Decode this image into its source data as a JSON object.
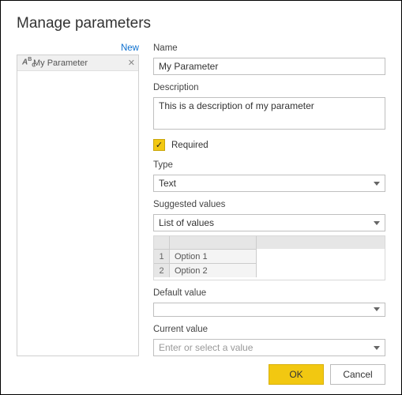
{
  "title": "Manage parameters",
  "sidebar": {
    "new_label": "New",
    "items": [
      {
        "icon": "ABC",
        "label": "My Parameter"
      }
    ]
  },
  "form": {
    "name_label": "Name",
    "name_value": "My Parameter",
    "description_label": "Description",
    "description_value": "This is a description of my parameter",
    "required_label": "Required",
    "required_checked": true,
    "type_label": "Type",
    "type_value": "Text",
    "suggested_label": "Suggested values",
    "suggested_value": "List of values",
    "values": [
      {
        "index": "1",
        "text": "Option 1"
      },
      {
        "index": "2",
        "text": "Option 2"
      }
    ],
    "default_label": "Default value",
    "default_value": "",
    "current_label": "Current value",
    "current_placeholder": "Enter or select a value"
  },
  "buttons": {
    "ok": "OK",
    "cancel": "Cancel"
  }
}
